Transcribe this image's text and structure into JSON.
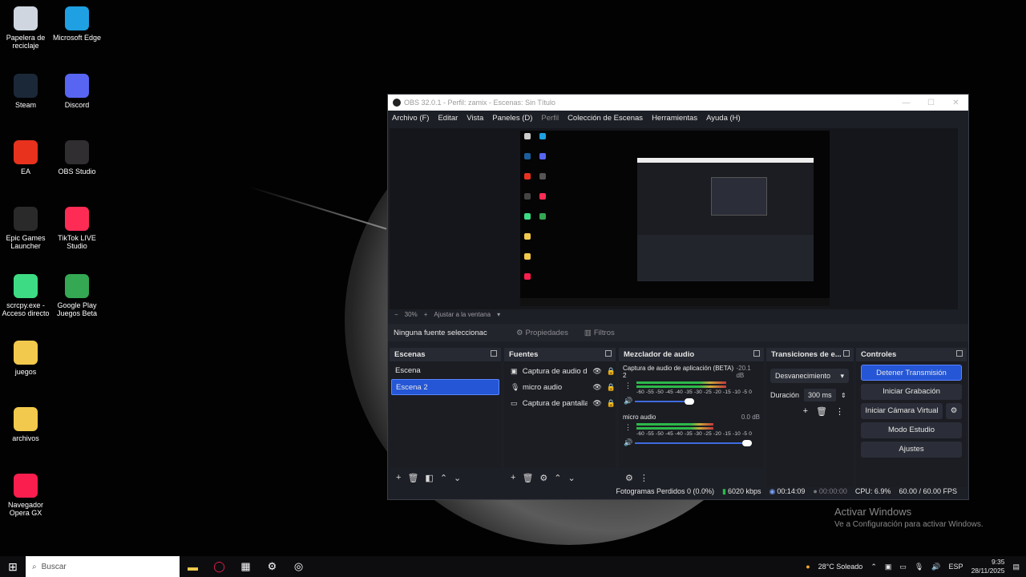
{
  "desktop": {
    "icons": [
      {
        "label": "Papelera de\nreciclaje",
        "icon": "recycle-bin-icon",
        "color": "#cfd6e0"
      },
      {
        "label": "Microsoft Edge",
        "icon": "edge-icon",
        "color": "#1fa0e3"
      },
      {
        "label": "Steam",
        "icon": "steam-icon",
        "color": "#1b2838"
      },
      {
        "label": "Discord",
        "icon": "discord-icon",
        "color": "#5865f2"
      },
      {
        "label": "EA",
        "icon": "ea-icon",
        "color": "#e8321e"
      },
      {
        "label": "OBS Studio",
        "icon": "obs-icon",
        "color": "#302e31"
      },
      {
        "label": "Epic Games\nLauncher",
        "icon": "epic-games-icon",
        "color": "#2a2a2a"
      },
      {
        "label": "TikTok LIVE\nStudio",
        "icon": "tiktok-icon",
        "color": "#fe2c55"
      },
      {
        "label": "scrcpy.exe -\nAcceso directo",
        "icon": "android-icon",
        "color": "#3ddc84"
      },
      {
        "label": "Google Play\nJuegos Beta",
        "icon": "google-play-games-icon",
        "color": "#34a853"
      },
      {
        "label": "juegos",
        "icon": "folder-icon",
        "color": "#f2c94c"
      },
      {
        "label": "archivos",
        "icon": "folder-icon",
        "color": "#f2c94c"
      },
      {
        "label": "Navegador\nOpera GX",
        "icon": "opera-gx-icon",
        "color": "#fa1e4e"
      }
    ],
    "activate_title": "Activar Windows",
    "activate_sub": "Ve a Configuración para activar Windows."
  },
  "obs": {
    "title": "OBS 32.0.1 - Perfil: zamix - Escenas: Sin Título",
    "menu": [
      "Archivo (F)",
      "Editar",
      "Vista",
      "Paneles (D)",
      "Perfil",
      "Colección de Escenas",
      "Herramientas",
      "Ayuda (H)"
    ],
    "zoom": {
      "minus": "−",
      "level": "30%",
      "plus": "+",
      "fit": "Ajustar a la ventana"
    },
    "no_source": "Ninguna fuente seleccionac",
    "properties": "Propiedades",
    "filters": "Filtros",
    "scenes": {
      "title": "Escenas",
      "items": [
        "Escena",
        "Escena 2"
      ],
      "selected": 1
    },
    "sources": {
      "title": "Fuentes",
      "items": [
        {
          "label": "Captura de audio de",
          "icon": "audio-capture-icon"
        },
        {
          "label": "micro audio",
          "icon": "microphone-icon"
        },
        {
          "label": "Captura de pantalla",
          "icon": "display-capture-icon"
        }
      ]
    },
    "mixer": {
      "title": "Mezclador de audio",
      "channels": [
        {
          "name": "Captura de audio de aplicación (BETA) 2",
          "db": "-20.1 dB",
          "level": 0.72,
          "volume": 0.45
        },
        {
          "name": "micro audio",
          "db": "0.0 dB",
          "level": 0.62,
          "volume": 0.97
        }
      ],
      "ticks": "-60 -55 -50 -45 -40 -35 -30 -25 -20 -15 -10 -5 0"
    },
    "transitions": {
      "title": "Transiciones de e...",
      "selected": "Desvanecimiento",
      "duration_label": "Duración",
      "duration": "300 ms"
    },
    "controls": {
      "title": "Controles",
      "stop_stream": "Detener Transmisión",
      "start_record": "Iniciar Grabación",
      "virtual_cam": "Iniciar Cámara Virtual",
      "studio_mode": "Modo Estudio",
      "settings": "Ajustes"
    },
    "status": {
      "dropped": "Fotogramas Perdidos 0 (0.0%)",
      "bitrate": "6020 kbps",
      "stream_time": "00:14:09",
      "record_time": "00:00:00",
      "cpu": "CPU: 6.9%",
      "fps": "60.00 / 60.00 FPS"
    }
  },
  "taskbar": {
    "search_placeholder": "Buscar",
    "weather": "28°C  Soleado",
    "lang": "ESP",
    "time": "9:35",
    "date": "28/11/2025"
  },
  "colors": {
    "accent": "#2456d6",
    "panel": "#1d1f26",
    "meter_green": "#2db84a"
  }
}
